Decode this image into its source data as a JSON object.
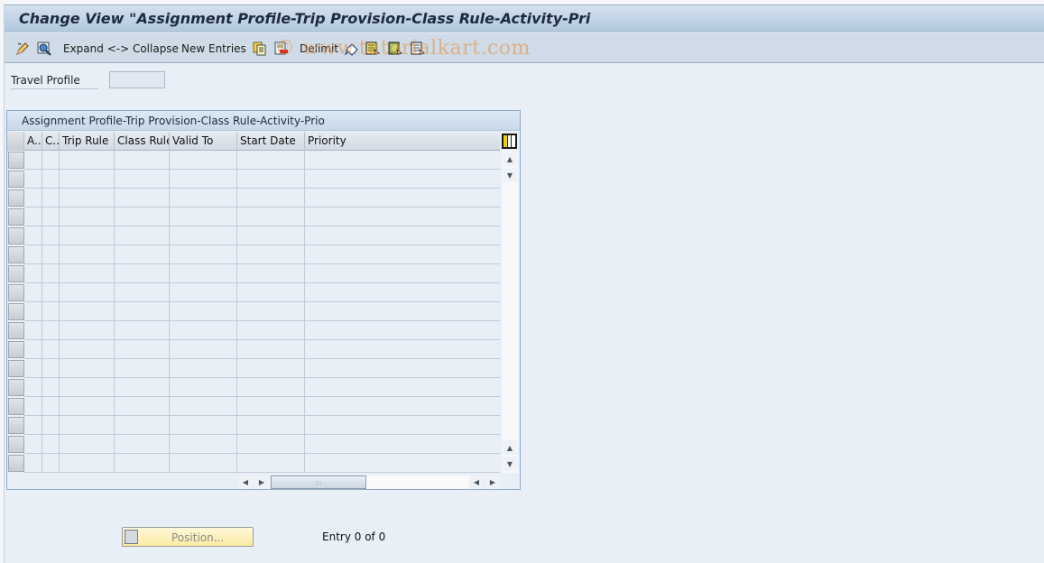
{
  "window": {
    "title": "Change View \"Assignment Profile-Trip Provision-Class Rule-Activity-Pri"
  },
  "toolbar": {
    "items": [
      {
        "icon": "change-display-icon",
        "label": ""
      },
      {
        "icon": "find-icon",
        "label": ""
      },
      {
        "icon": "",
        "label": "Expand <-> Collapse"
      },
      {
        "icon": "",
        "label": "New Entries"
      },
      {
        "icon": "copy-icon",
        "label": ""
      },
      {
        "icon": "delete-icon",
        "label": ""
      },
      {
        "icon": "",
        "label": "Delimit"
      },
      {
        "icon": "undo-change-icon",
        "label": ""
      },
      {
        "icon": "select-all-icon",
        "label": ""
      },
      {
        "icon": "select-block-icon",
        "label": ""
      },
      {
        "icon": "deselect-all-icon",
        "label": ""
      }
    ],
    "watermark": "© www.tutorialkart.com"
  },
  "header_fields": {
    "travel_profile": {
      "label": "Travel Profile",
      "value": ""
    }
  },
  "table": {
    "title": "Assignment Profile-Trip Provision-Class Rule-Activity-Prio",
    "columns": [
      "A..",
      "C..",
      "Trip Rule",
      "Class Rule",
      "Valid To",
      "Start Date",
      "Priority"
    ],
    "rows": 17,
    "accent_colors": {
      "header_bg": "#d3dbe4",
      "cell_bg": "#e8eff7",
      "border": "#8fa9c6"
    }
  },
  "footer": {
    "position_button": "Position...",
    "entry_info": "Entry 0 of 0"
  }
}
